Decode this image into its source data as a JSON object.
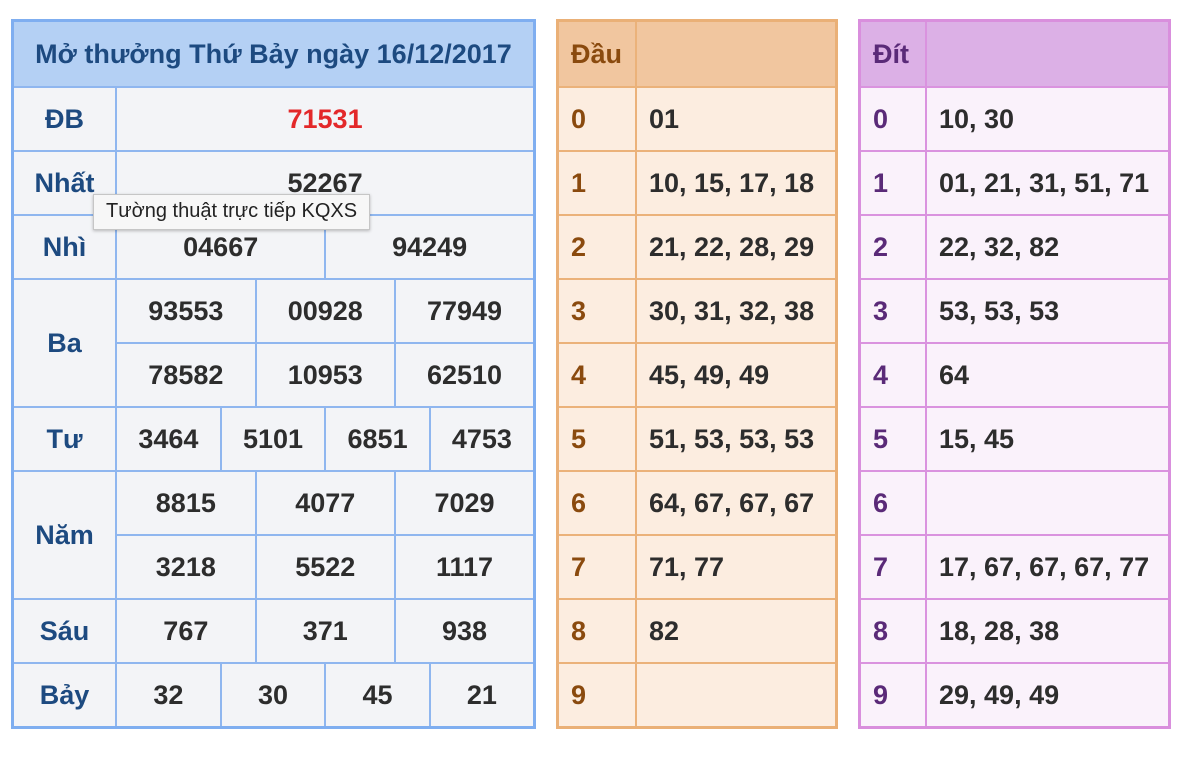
{
  "results": {
    "title": "Mở thưởng Thứ Bảy ngày 16/12/2017",
    "prizes": [
      {
        "label": "ĐB",
        "rows": [
          [
            "71531"
          ]
        ]
      },
      {
        "label": "Nhất",
        "rows": [
          [
            "52267"
          ]
        ]
      },
      {
        "label": "Nhì",
        "rows": [
          [
            "04667",
            "94249"
          ]
        ]
      },
      {
        "label": "Ba",
        "rows": [
          [
            "93553",
            "00928",
            "77949"
          ],
          [
            "78582",
            "10953",
            "62510"
          ]
        ]
      },
      {
        "label": "Tư",
        "rows": [
          [
            "3464",
            "5101",
            "6851",
            "4753"
          ]
        ]
      },
      {
        "label": "Năm",
        "rows": [
          [
            "8815",
            "4077",
            "7029"
          ],
          [
            "3218",
            "5522",
            "1117"
          ]
        ]
      },
      {
        "label": "Sáu",
        "rows": [
          [
            "767",
            "371",
            "938"
          ]
        ]
      },
      {
        "label": "Bảy",
        "rows": [
          [
            "32",
            "30",
            "45",
            "21"
          ]
        ]
      }
    ]
  },
  "tooltip": "Tường thuật trực tiếp KQXS",
  "dau": {
    "header": "Đầu",
    "rows": [
      {
        "digit": "0",
        "values": "01"
      },
      {
        "digit": "1",
        "values": "10, 15, 17, 18"
      },
      {
        "digit": "2",
        "values": "21, 22, 28, 29"
      },
      {
        "digit": "3",
        "values": "30, 31, 32, 38"
      },
      {
        "digit": "4",
        "values": "45, 49, 49"
      },
      {
        "digit": "5",
        "values": "51, 53, 53, 53"
      },
      {
        "digit": "6",
        "values": "64, 67, 67, 67"
      },
      {
        "digit": "7",
        "values": "71, 77"
      },
      {
        "digit": "8",
        "values": "82"
      },
      {
        "digit": "9",
        "values": ""
      }
    ]
  },
  "dit": {
    "header": "Đít",
    "rows": [
      {
        "digit": "0",
        "values": "10, 30"
      },
      {
        "digit": "1",
        "values": "01, 21, 31, 51, 71"
      },
      {
        "digit": "2",
        "values": "22, 32, 82"
      },
      {
        "digit": "3",
        "values": "53, 53, 53"
      },
      {
        "digit": "4",
        "values": "64"
      },
      {
        "digit": "5",
        "values": "15, 45"
      },
      {
        "digit": "6",
        "values": ""
      },
      {
        "digit": "7",
        "values": "17, 67, 67, 67, 77"
      },
      {
        "digit": "8",
        "values": "18, 28, 38"
      },
      {
        "digit": "9",
        "values": "29, 49, 49"
      }
    ]
  },
  "colors": {
    "special_prize": "#e3282a",
    "result_header": "#b4d0f4",
    "dau_header": "#f1c69f",
    "dit_header": "#dcb0e6"
  }
}
